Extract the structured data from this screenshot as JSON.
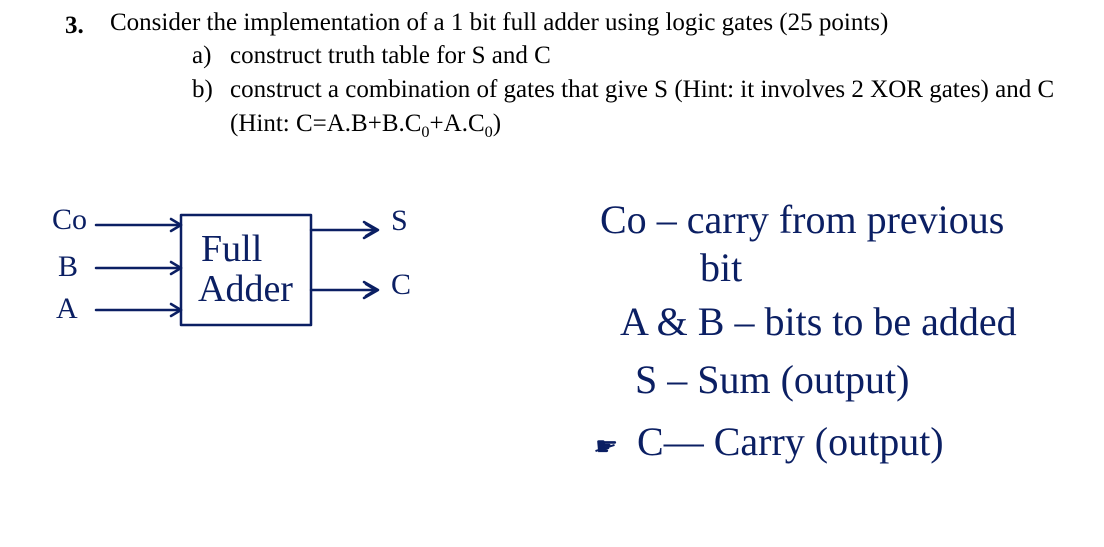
{
  "problem": {
    "number": "3.",
    "text": "Consider the implementation of a 1 bit full adder using logic gates (25 points)",
    "parts": {
      "a": {
        "label": "a)",
        "text": "construct truth table for S and C"
      },
      "b": {
        "label": "b)",
        "line1": "construct a combination of gates that give S (Hint: it involves 2 XOR gates) and C",
        "line2_prefix": "(Hint: C=A.B+B.C",
        "line2_sub1": "0",
        "line2_mid": "+A.C",
        "line2_sub2": "0",
        "line2_suffix": ")"
      }
    }
  },
  "diagram": {
    "inputs": {
      "co": "Co",
      "b": "B",
      "a": "A"
    },
    "box": {
      "line1": "Full",
      "line2": "Adder"
    },
    "outputs": {
      "s": "S",
      "c": "C"
    }
  },
  "legend": {
    "co": {
      "label": "Co",
      "dash": " – ",
      "text1": "carry from previous",
      "text2": "bit"
    },
    "ab": {
      "label": "A & B",
      "dash": " – ",
      "text": "bits to be added"
    },
    "s": {
      "label": "S",
      "dash": " – ",
      "text": "Sum (output)"
    },
    "c": {
      "bullet": "☛",
      "label": "C",
      "dash": "— ",
      "text": "Carry (output)"
    }
  }
}
